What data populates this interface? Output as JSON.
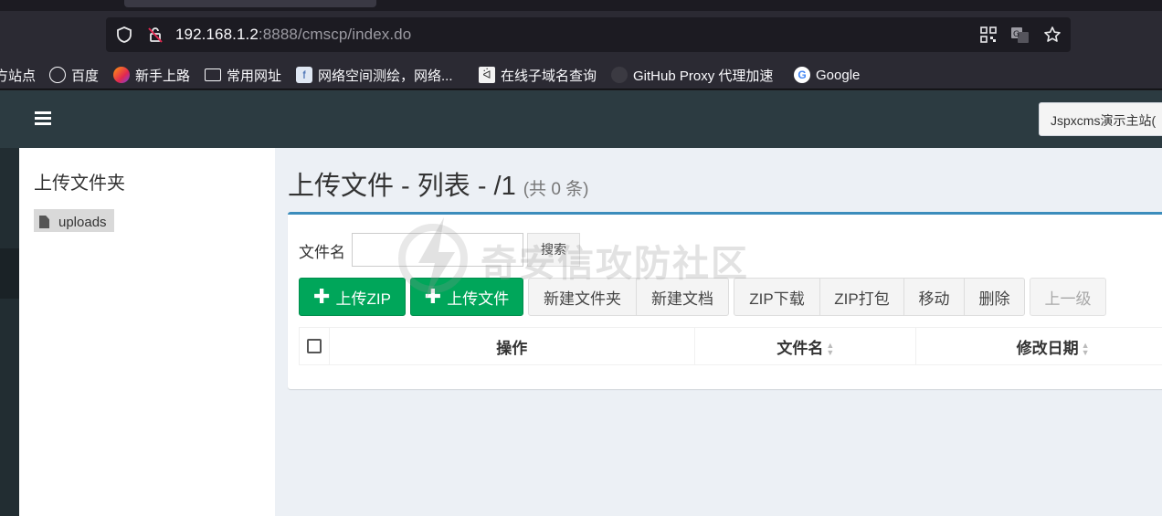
{
  "browser": {
    "url_host": "192.168.1.2",
    "url_rest": ":8888/cmscp/index.do",
    "bookmarks": [
      {
        "label": "方站点",
        "icon": "site-icon"
      },
      {
        "label": "百度",
        "icon": "globe-icon"
      },
      {
        "label": "新手上路",
        "icon": "firefox-icon"
      },
      {
        "label": "常用网址",
        "icon": "folder-icon"
      },
      {
        "label": "网络空间测绘，网络...",
        "icon": "fofa-icon"
      },
      {
        "label": "在线子域名查询",
        "icon": "cat-icon"
      },
      {
        "label": "GitHub Proxy 代理加速",
        "icon": "github-icon"
      },
      {
        "label": "Google",
        "icon": "google-icon"
      }
    ]
  },
  "header": {
    "site_select": "Jspxcms演示主站("
  },
  "tree": {
    "title": "上传文件夹",
    "nodes": [
      {
        "label": "uploads"
      }
    ]
  },
  "main": {
    "title": "上传文件 - 列表 - /1",
    "count": "(共 0 条)",
    "search_label": "文件名",
    "search_value": "",
    "search_button": "搜索",
    "buttons": {
      "upload_zip": "上传ZIP",
      "upload_file": "上传文件",
      "new_folder": "新建文件夹",
      "new_doc": "新建文档",
      "zip_download": "ZIP下载",
      "zip_pack": "ZIP打包",
      "move": "移动",
      "delete": "删除",
      "up_level": "上一级"
    },
    "columns": {
      "operation": "操作",
      "filename": "文件名",
      "modified": "修改日期"
    }
  },
  "watermark": "奇安信攻防社区",
  "colors": {
    "header_bg": "#2c3b41",
    "box_accent": "#3c8dbc",
    "success": "#00a65a"
  }
}
